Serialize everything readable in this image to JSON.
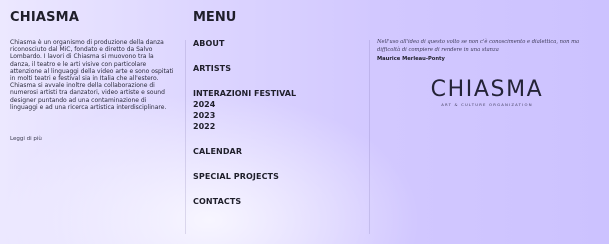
{
  "left": {
    "brand": "CHIASMA",
    "description": "Chiasma è un organismo di produzione della danza riconosciuto dal MiC, fondato e diretto da Salvo Lombardo. I lavori di Chiasma si muovono tra la danza, il teatro e le arti visive con particolare attenzione al linguaggi della video arte e sono ospitati in molti teatri e festival sia in Italia che all'estero. Chiasma si avvale inoltre della collaborazione di numerosi artisti tra danzatori, video artiste e sound designer puntando ad una contaminazione di linguaggi e ad una ricerca artistica interdisciplinare.",
    "read_more": "Leggi di più"
  },
  "menu": {
    "title": "MENU",
    "items": [
      {
        "label": "ABOUT"
      },
      {
        "label": "ARTISTS"
      },
      {
        "label": "INTERAZIONI FESTIVAL",
        "years": [
          "2024",
          "2023",
          "2022"
        ]
      },
      {
        "label": "CALENDAR"
      },
      {
        "label": "SPECIAL PROJECTS"
      },
      {
        "label": "CONTACTS"
      }
    ]
  },
  "right": {
    "quote": "Nell'uso all'idea di questo volto se non c'è conoscimento e dialettica, non ma difficoltà di compiere di rendere in una stanza",
    "author": "Maurice Merleau-Ponty",
    "logo": {
      "text": "CHIASMA",
      "subtext": "ART & CULTURE ORGANIZATION"
    }
  },
  "colors": {
    "background_gradient_start": "#ece8ff",
    "background_gradient_end": "#ccc2ff",
    "text_primary": "#1f1f2b"
  }
}
